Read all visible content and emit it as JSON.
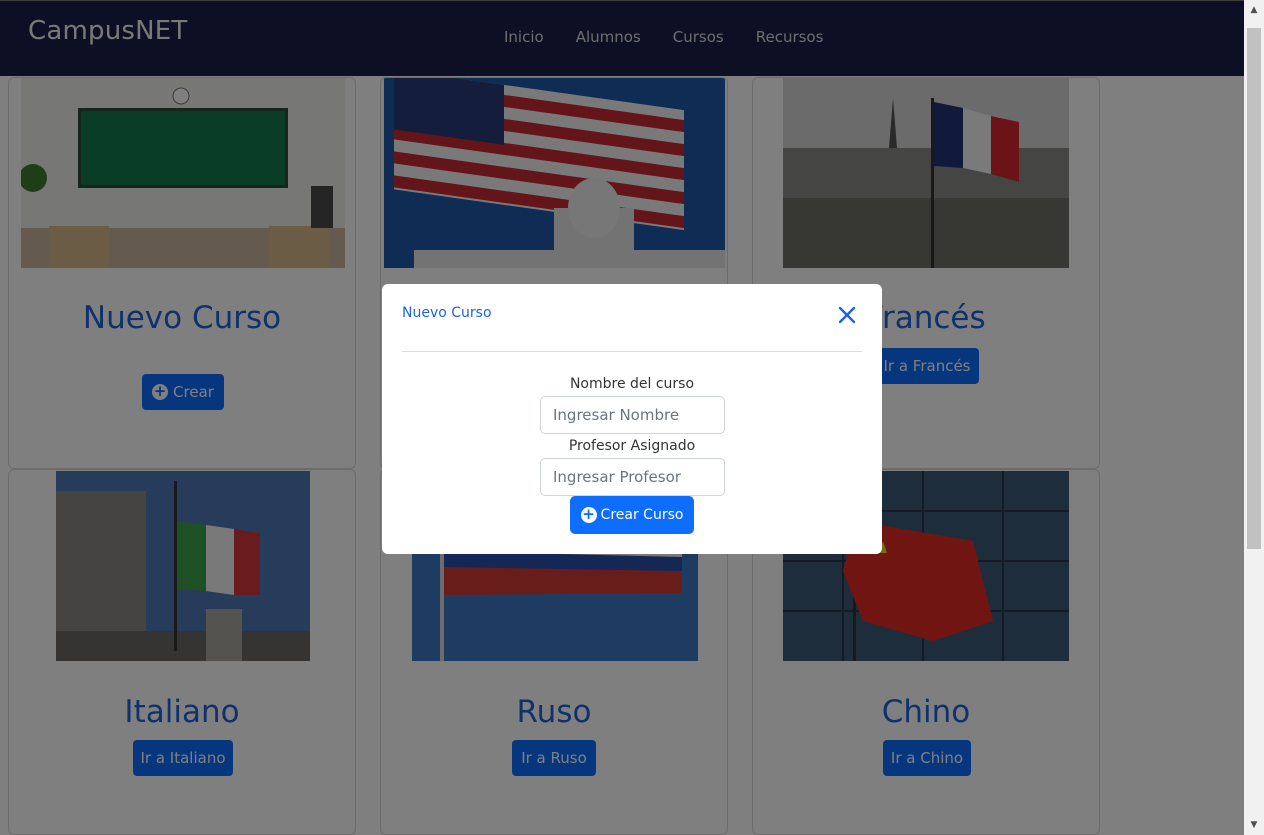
{
  "app": {
    "brand": "CampusNET"
  },
  "nav": {
    "items": [
      "Inicio",
      "Alumnos",
      "Cursos",
      "Recursos"
    ]
  },
  "cards": {
    "nuevo": {
      "title": "Nuevo Curso",
      "button": "Crear"
    },
    "ingles": {
      "title": "",
      "button": ""
    },
    "frances": {
      "title": "Francés",
      "button": "Ir a Francés"
    },
    "italiano": {
      "title": "Italiano",
      "button": "Ir a Italiano"
    },
    "ruso": {
      "title": "Ruso",
      "button": "Ir a Ruso"
    },
    "chino": {
      "title": "Chino",
      "button": "Ir a Chino"
    }
  },
  "modal": {
    "title": "Nuevo Curso",
    "name_label": "Nombre del curso",
    "name_placeholder": "Ingresar Nombre",
    "name_value": "",
    "teacher_label": "Profesor Asignado",
    "teacher_placeholder": "Ingresar Profesor",
    "teacher_value": "",
    "submit": "Crear Curso"
  },
  "colors": {
    "navbar": "#1b1f4b",
    "primary": "#0d6efd",
    "title": "#1e64d8"
  }
}
